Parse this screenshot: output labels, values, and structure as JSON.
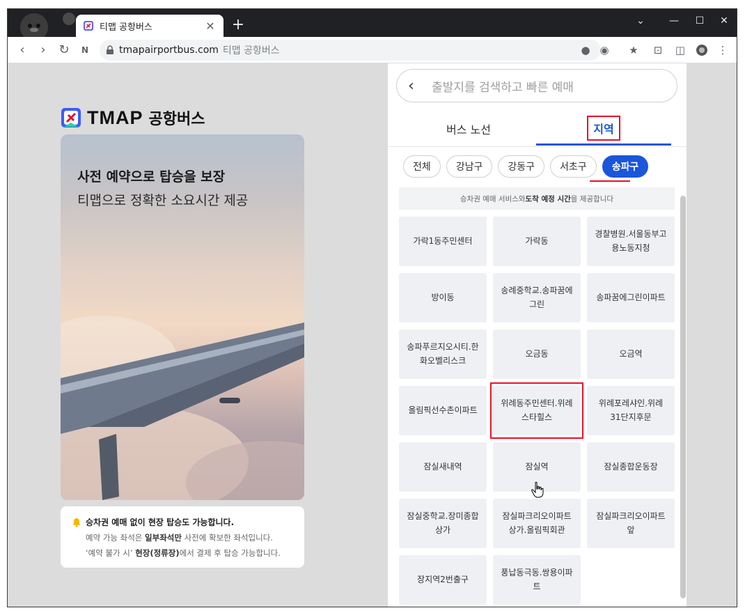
{
  "browser": {
    "tab_title": "티맵 공항버스",
    "tab_close": "✕",
    "new_tab": "+",
    "url": "tmapairportbus.com",
    "url_subtitle": "티맵 공항버스",
    "window_controls": {
      "dropdown": "⌄",
      "minimize": "—",
      "maximize": "☐",
      "close": "✕"
    },
    "nav": {
      "back": "‹",
      "forward": "›",
      "reload": "↻",
      "extension": "N"
    },
    "toolbar_icons": {
      "location": "●",
      "eye": "◉",
      "star": "★",
      "screenshot": "⊡",
      "split": "◫",
      "menu": "⋮"
    }
  },
  "left": {
    "brand": "TMAP",
    "brand_ko": "공항버스",
    "hero_title": "사전 예약으로 탑승을 보장",
    "hero_subtitle": "티맵으로 정확한 소요시간 제공",
    "notice_title": "승차권 예매 없이 현장 탑승도 가능합니다.",
    "notice_line2_a": "예약 가능 좌석은 ",
    "notice_line2_b": "일부좌석만",
    "notice_line2_c": " 사전에 확보한 좌석입니다.",
    "notice_line3_a": "‘예약 불가 시’ ",
    "notice_line3_b": "현장(정류장)",
    "notice_line3_c": "에서 결제 후 탑승 가능합니다."
  },
  "panel": {
    "back": "‹",
    "search_placeholder": "출발지를 검색하고 빠른 예매",
    "tabs": [
      "버스 노선",
      "지역"
    ],
    "chips": [
      "전체",
      "강남구",
      "강동구",
      "서초구",
      "송파구"
    ],
    "active_chip": "송파구",
    "info_a": "승차권 예매 서비스와 ",
    "info_b": "도착 예정 시간",
    "info_c": "을 제공합니다",
    "stops": [
      "가락1동주민센터",
      "가락동",
      "경찰병원.서울동부고용노동지청",
      "방이동",
      "송례중학교.송파꿈에그린",
      "송파꿈에그린이파트",
      "송파푸르지오시티.한화오벨리스크",
      "오금동",
      "오금역",
      "올림픽선수촌이파트",
      "위례동주민센터.위례스타힐스",
      "위례포레샤인.위례31단지후문",
      "잠실새내역",
      "잠실역",
      "잠실종합운동장",
      "잠실중학교.장미종합상가",
      "잠실파크리오이파트상가.올림픽회관",
      "잠실파크리오이파트앞",
      "장지역2번출구",
      "풍납동극동.쌍용이파트"
    ],
    "highlighted_stop": "위례동주민센터.위례스타힐스"
  },
  "colors": {
    "accent": "#1a56db",
    "highlight": "#e8102a"
  }
}
